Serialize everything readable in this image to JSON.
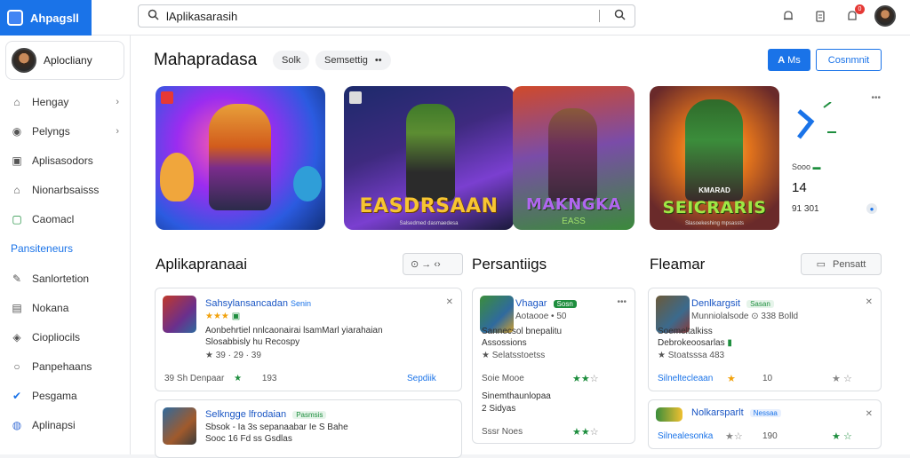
{
  "app": {
    "brand": "Ahpagsll"
  },
  "search": {
    "value": "lAplikasarasih"
  },
  "top": {
    "notif_count": "0"
  },
  "sidebar": {
    "profile_name": "Aplocliany",
    "items": [
      {
        "label": "Hengay",
        "chev": "›"
      },
      {
        "label": "Pelyngs",
        "chev": "›"
      },
      {
        "label": "Aplisasodors",
        "chev": ""
      },
      {
        "label": "Nionarbsaisss",
        "chev": ""
      },
      {
        "label": "Caomacl",
        "chev": ""
      }
    ],
    "section": "Pansiteneurs",
    "items2": [
      {
        "label": "Sanlortetion"
      },
      {
        "label": "Nokana"
      },
      {
        "label": "Ciopliocils"
      },
      {
        "label": "Panpehaans"
      },
      {
        "label": "Pesgama"
      },
      {
        "label": "Aplinapsi"
      }
    ]
  },
  "header": {
    "title": "Mahapradasa",
    "chip1": "Solk",
    "chip2": "Semsettig",
    "chip2_more": "••",
    "btn_primary": "Ms",
    "btn_outline": "Cosnmnit"
  },
  "banners": [
    {
      "title": "",
      "sub": ""
    },
    {
      "title": "EASDRSAAN",
      "sub": "Salsedmed dasmaedesa"
    },
    {
      "title": "MAKNGKA",
      "title2": "EASS",
      "sub": ""
    },
    {
      "title": "SEICRARIS",
      "top": "KMARAD",
      "sub": "Slasoekeshing mpsassts"
    }
  ],
  "side_panel": {
    "label": "Sooo",
    "number": "14",
    "sub": "91 301",
    "more": "•••"
  },
  "sections": [
    {
      "title": "Aplikapranaai",
      "ctrl": "⊙ → ‹›"
    },
    {
      "title": "Persantiigs"
    },
    {
      "title": "Fleamar",
      "ctrl": "Pensatt"
    }
  ],
  "cards": {
    "c1": {
      "name": "Sahsylansancadan",
      "tag": "Senin",
      "rating": "★★★",
      "line1": "Aonbehrtiel nnlcaonairai lsamMarl yiarahaian",
      "line2": "Slosabbisly hu Recospy",
      "meta1": "★ 39 · 29 · 39",
      "foot1": "39 Sh Denpaar",
      "foot2": "193",
      "link": "Sepdiik"
    },
    "c2": {
      "name": "Selkngge lfrodaian",
      "tag": "Pasmsis",
      "line1": "Sbsok - Ia 3s sepanaabar Ie S Bahe",
      "line2": "Sooc 16 Fd ss Gsdlas"
    },
    "c3": {
      "name": "Vhagar",
      "tag": "Sosn",
      "sub": "Aotaooe • 50",
      "line1": "Sannecsol bnepalitu",
      "line2": "Assossions",
      "meta1": "★ Selatsstoetss",
      "foot1": "Soie Mooe",
      "line3": "Sinemthaunlopaa",
      "line4": "2 Sidyas",
      "foot2": "Sssr Noes"
    },
    "c4": {
      "name": "Denlkargsit",
      "tag": "Sasan",
      "sub": "Munniolalsode ⊙ 338 Bolld",
      "line1": "Soemeltalkiss",
      "line2": "Debrokeoosarlas",
      "meta1": "★ Stoatsssa 483",
      "link": "Silneltecleaan",
      "foot2": "10"
    },
    "c5": {
      "name": "Nolkarsparlt",
      "tag": "Nessaa",
      "link": "Silnealesonka",
      "foot2": "190"
    }
  },
  "colors": {
    "accent": "#1a73e8",
    "green": "#1e8e3e",
    "star": "#f2a20c"
  }
}
